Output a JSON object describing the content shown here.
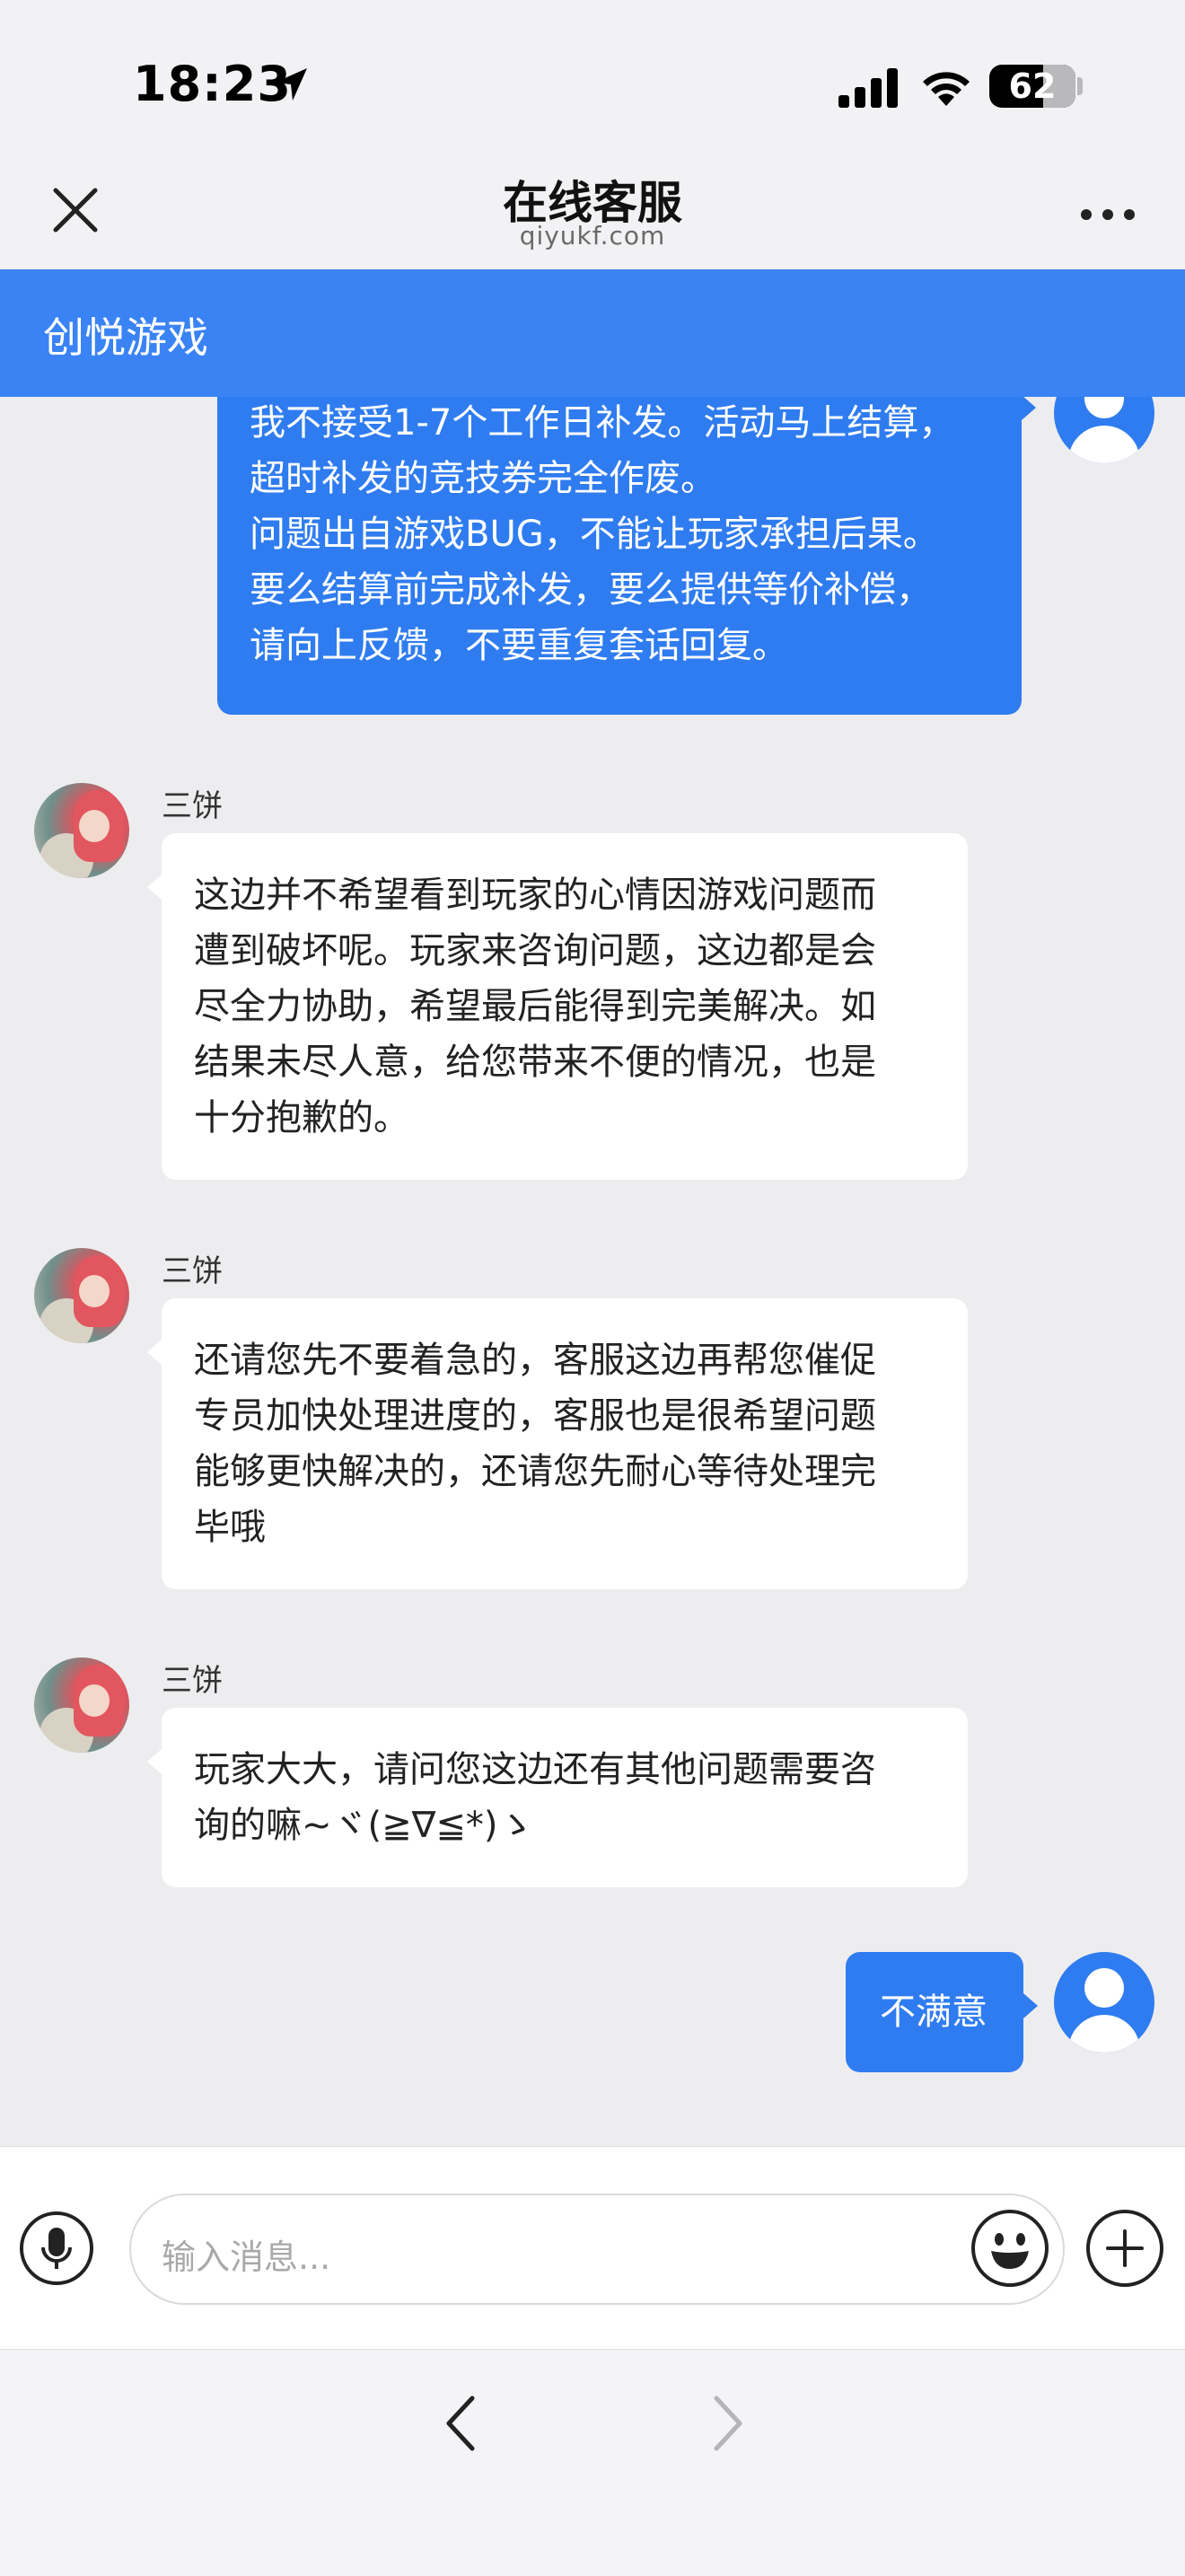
{
  "status_bar": {
    "time": "18:23",
    "battery": "62",
    "battery_level": 0.62
  },
  "nav": {
    "title": "在线客服",
    "subtitle": "qiyukf.com"
  },
  "brand": {
    "name": "创悦游戏"
  },
  "messages": [
    {
      "sender": "user",
      "lines": [
        "我不接受1-7个工作日补发。活动马上结算，",
        "超时补发的竞技券完全作废。",
        "问题出自游戏BUG，不能让玩家承担后果。",
        "要么结算前完成补发，要么提供等价补偿，",
        "请向上反馈，不要重复套话回复。"
      ]
    },
    {
      "sender": "agent",
      "name": "三饼",
      "lines": [
        "这边并不希望看到玩家的心情因游戏问题而",
        "遭到破坏呢。玩家来咨询问题，这边都是会",
        "尽全力协助，希望最后能得到完美解决。如",
        "结果未尽人意，给您带来不便的情况，也是",
        "十分抱歉的。"
      ]
    },
    {
      "sender": "agent",
      "name": "三饼",
      "lines": [
        "还请您先不要着急的，客服这边再帮您催促",
        "专员加快处理进度的，客服也是很希望问题",
        "能够更快解决的，还请您先耐心等待处理完",
        "毕哦"
      ]
    },
    {
      "sender": "agent",
      "name": "三饼",
      "lines": [
        "玩家大大，请问您这边还有其他问题需要咨",
        "询的嘛~ヾ(≧∇≦*)ゝ"
      ]
    },
    {
      "sender": "user",
      "lines": [
        "不满意"
      ]
    }
  ],
  "input": {
    "placeholder": "输入消息..."
  },
  "icons": {
    "close": "close-icon",
    "more": "more-icon",
    "mic": "microphone-icon",
    "emoji": "emoji-icon",
    "plus": "plus-icon",
    "back": "chevron-left-icon",
    "forward": "chevron-right-icon",
    "location": "location-arrow-icon",
    "signal": "cellular-signal-icon",
    "wifi": "wifi-icon"
  },
  "colors": {
    "brand_blue": "#3a83f5",
    "user_bubble": "#2f7cf0",
    "agent_bubble": "#ffffff",
    "chat_background": "#ededef"
  }
}
